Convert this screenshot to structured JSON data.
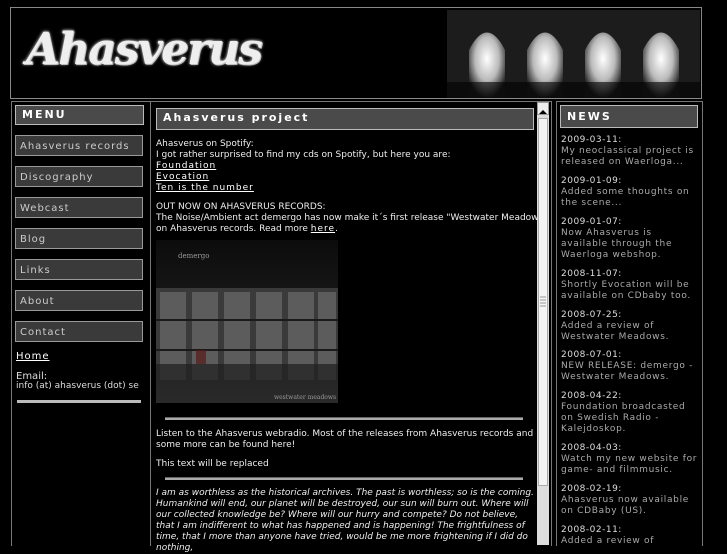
{
  "header": {
    "logo_text": "Ahasverus"
  },
  "menu": {
    "title": "MENU",
    "items": [
      "Ahasverus records",
      "Discography",
      "Webcast",
      "Blog",
      "Links",
      "About",
      "Contact"
    ],
    "home_label": "Home",
    "email_label": "Email:",
    "email_value": "info (at) ahasverus (dot) se"
  },
  "main": {
    "title": "Ahasverus project",
    "spotify_line1": "Ahasverus on Spotify:",
    "spotify_line2": "I got rather surprised to find my cds on Spotify, but here you are:",
    "spotify_links": [
      "Foundation",
      "Evocation",
      "Ten is the number"
    ],
    "news_line1": "OUT NOW ON AHASVERUS RECORDS:",
    "news_line2": "The Noise/Ambient act demergo has now make it´s first release \"Westwater Meadows\"",
    "news_line3": "on Ahasverus records. Read more",
    "news_link": "here",
    "news_link_suffix": ".",
    "photo_label_top": "demergo",
    "photo_label_bottom": "westwater meadows",
    "webradio_line1": "Listen to the Ahasverus webradio. Most of the releases from Ahasverus records and",
    "webradio_line2": "some more can be found here!",
    "placeholder_text": "This text will be replaced",
    "quote": "I am as worthless as the historical archives. The past is worthless; so is the coming. Humankind will end, our planet will be destroyed, our sun will burn out. Where will our collected knowledge be? Where will our hurry and compete? Do not believe, that I am indifferent to what has happened and is happening! The frightfulness of time, that I more than anyone have tried, would be me more frightening if I did do nothing,"
  },
  "news": {
    "title": "NEWS",
    "entries": [
      {
        "date": "2009-03-11:",
        "text": "My neoclassical project is released on Waerloga..."
      },
      {
        "date": "2009-01-09:",
        "text": "Added some thoughts on the scene..."
      },
      {
        "date": "2009-01-07:",
        "text": "Now Ahasverus is available through the Waerloga webshop."
      },
      {
        "date": "2008-11-07:",
        "text": "Shortly Evocation will be available on CDbaby too."
      },
      {
        "date": "2008-07-25:",
        "text": "Added a review of Westwater Meadows."
      },
      {
        "date": "2008-07-01:",
        "text": "NEW RELEASE: demergo - Westwater Meadows."
      },
      {
        "date": "2008-04-22:",
        "text": "Foundation broadcasted on Swedish Radio - Kalejdoskop."
      },
      {
        "date": "2008-04-03:",
        "text": "Watch my new website for game- and filmmusic."
      },
      {
        "date": "2008-02-19:",
        "text": "Ahasverus now available on CDBaby (US)."
      },
      {
        "date": "2008-02-11:",
        "text": "Added a review of"
      }
    ]
  },
  "colors": {
    "background": "#000000",
    "panel_title_bg": "#4a4a4a",
    "menu_button_bg": "#3a3a3a",
    "border": "#888888"
  }
}
